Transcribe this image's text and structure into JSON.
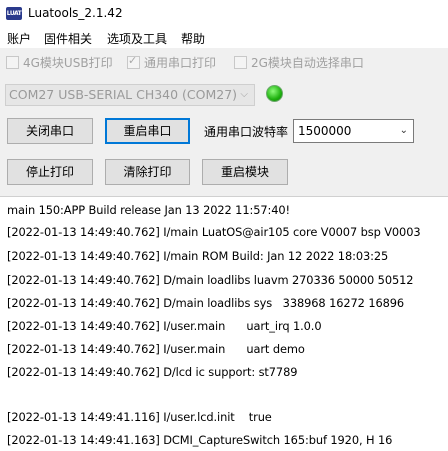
{
  "window": {
    "title": "Luatools_2.1.42",
    "icon_text": "LUAT"
  },
  "menu": [
    "账户",
    "固件相关",
    "选项及工具",
    "帮助"
  ],
  "options": [
    {
      "label": "4G模块USB打印",
      "checked": false
    },
    {
      "label": "通用串口打印",
      "checked": true
    },
    {
      "label": "2G模块自动选择串口",
      "checked": false
    }
  ],
  "port": {
    "selected": "COM27 USB-SERIAL CH340 (COM27)",
    "status_color": "#1fb10f"
  },
  "buttons": {
    "close_port": "关闭串口",
    "restart_port": "重启串口",
    "stop_print": "停止打印",
    "clear_print": "清除打印",
    "restart_module": "重启模块"
  },
  "baud": {
    "label": "通用串口波特率",
    "value": "1500000"
  },
  "log": [
    "main 150:APP Build release Jan 13 2022 11:57:40!",
    "[2022-01-13 14:49:40.762] I/main LuatOS@air105 core V0007 bsp V0003",
    "[2022-01-13 14:49:40.762] I/main ROM Build: Jan 12 2022 18:03:25",
    "[2022-01-13 14:49:40.762] D/main loadlibs luavm 270336 50000 50512",
    "[2022-01-13 14:49:40.762] D/main loadlibs sys   338968 16272 16896",
    "[2022-01-13 14:49:40.762] I/user.main      uart_irq 1.0.0",
    "[2022-01-13 14:49:40.762] I/user.main      uart demo",
    "[2022-01-13 14:49:40.762] D/lcd ic support: st7789",
    "",
    "[2022-01-13 14:49:41.116] I/user.lcd.init    true",
    "[2022-01-13 14:49:41.163] DCMI_CaptureSwitch 165:buf 1920, H 16"
  ]
}
